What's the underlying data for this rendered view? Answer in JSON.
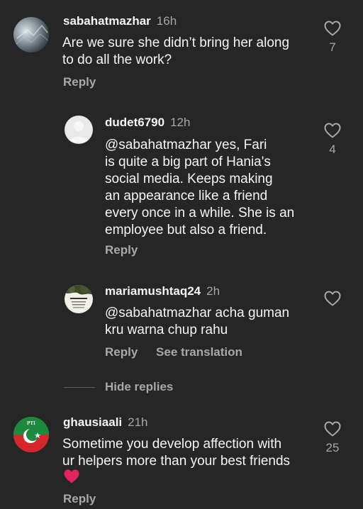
{
  "comments": [
    {
      "username": "sabahatmazhar",
      "time": "16h",
      "text": "Are we sure she didn’t bring her along\nto do all the work?",
      "reply_label": "Reply",
      "likes": "7"
    },
    {
      "username": "dudet6790",
      "time": "12h",
      "text": "@sabahatmazhar yes, Fari\nis quite a big part of Hania's\nsocial media. Keeps making\nan appearance like a friend\nevery once in a while. She is an\nemployee but also a friend.",
      "reply_label": "Reply",
      "likes": "4"
    },
    {
      "username": "mariamushtaq24",
      "time": "2h",
      "text": "@sabahatmazhar acha guman\nkru warna chup rahu",
      "reply_label": "Reply",
      "translation_label": "See translation",
      "likes": ""
    },
    {
      "username": "ghausiaali",
      "time": "21h",
      "text": "Sometime you develop affection with\nur helpers more than your best friends",
      "reply_label": "Reply",
      "likes": "25"
    }
  ],
  "hide_replies_label": "Hide replies",
  "icons": {
    "like": "heart-outline-icon",
    "emoji": "red-heart-emoji"
  },
  "colors": {
    "background": "#262626",
    "primary_text": "#f5f5f5",
    "secondary_text": "#a8a8a8",
    "emoji_red": "#e0245e"
  }
}
